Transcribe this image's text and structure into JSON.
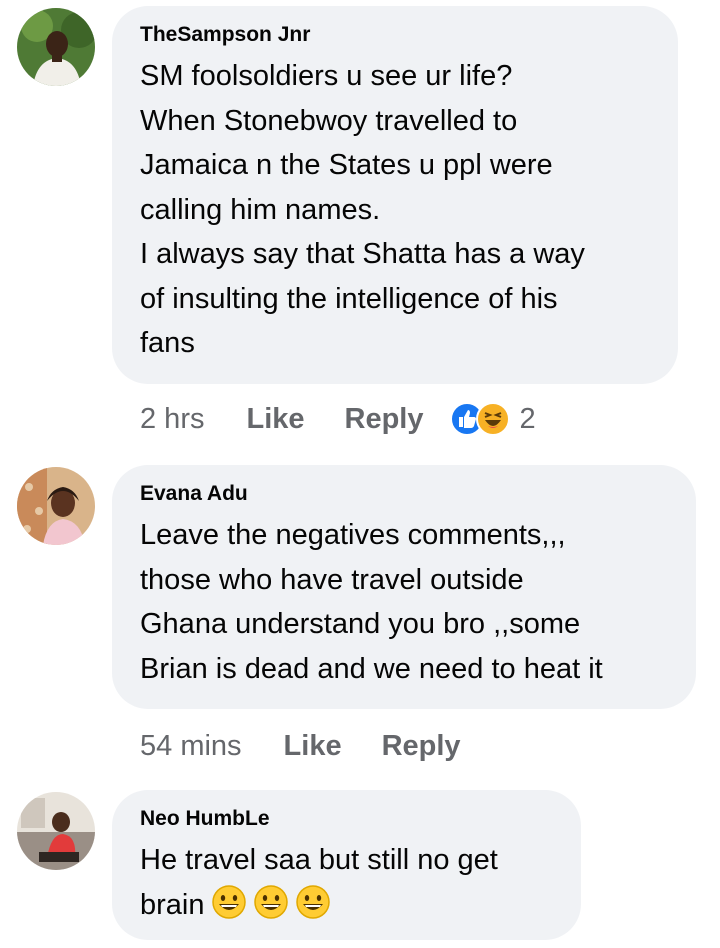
{
  "comments": [
    {
      "author": "TheSampson Jnr",
      "text": "SM foolsoldiers u see ur life?\nWhen Stonebwoy  travelled to\nJamaica n the States u ppl were\ncalling him names.\nI always say that Shatta has a way\nof insulting the intelligence of his\nfans",
      "time": "2 hrs",
      "like_label": "Like",
      "reply_label": "Reply",
      "reaction_icons": [
        "like-reaction-icon",
        "haha-reaction-icon"
      ],
      "reaction_count": "2"
    },
    {
      "author": "Evana Adu",
      "text": "Leave the negatives comments,,,\nthose who have travel outside\nGhana understand you bro ,,some\nBrian is dead and we need to heat it",
      "time": "54 mins",
      "like_label": "Like",
      "reply_label": "Reply"
    },
    {
      "author": "Neo HumbLe",
      "text_lines": [
        "He travel saa but still no get",
        "brain"
      ],
      "trailing_emojis": [
        "grinning-face-emoji",
        "grinning-face-emoji",
        "grinning-face-emoji"
      ]
    }
  ],
  "colors": {
    "bubble_bg": "#f0f2f5",
    "meta_text": "#65676b",
    "like_blue": "#1877f2",
    "haha_yellow": "#f7b125"
  }
}
